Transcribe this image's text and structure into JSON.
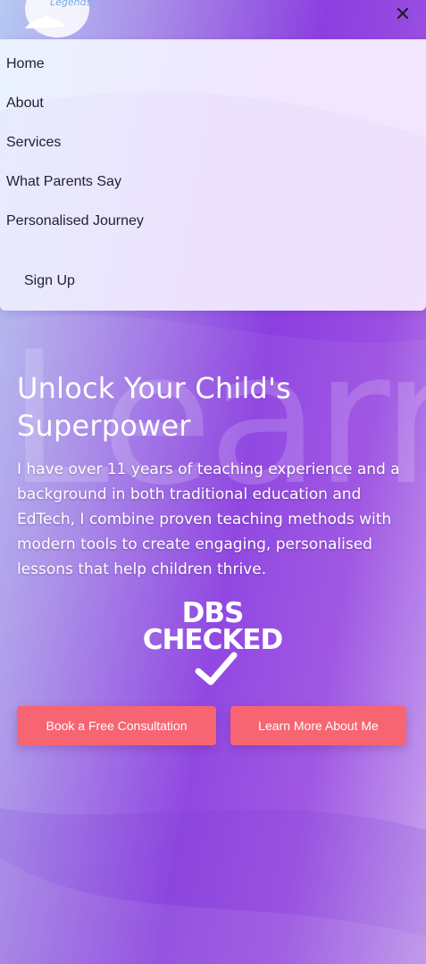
{
  "brand": {
    "logo_text": "Learning Legends"
  },
  "header": {
    "close_icon": "close-icon",
    "close_glyph": "✕"
  },
  "nav": {
    "items": [
      {
        "label": "Home"
      },
      {
        "label": "About"
      },
      {
        "label": "Services"
      },
      {
        "label": "What Parents Say"
      },
      {
        "label": "Personalised Journey"
      }
    ],
    "signup_label": "Sign Up"
  },
  "hero": {
    "watermark": "Learn Lege",
    "title": "Unlock Your Child's Superpower",
    "body": "I have over 11 years of teaching experience and a background in both traditional education and EdTech, I combine proven teaching methods with modern tools to create engaging, personalised lessons that help children thrive."
  },
  "badge": {
    "line1": "DBS",
    "line2": "CHECKED",
    "icon": "checkmark-icon"
  },
  "cta": {
    "primary_label": "Book a Free Consultation",
    "secondary_label": "Learn More About Me"
  },
  "colors": {
    "cta_background": "#f76572",
    "gradient_purple": "#8c3fe0",
    "gradient_light_blue": "#b7c9f2"
  }
}
